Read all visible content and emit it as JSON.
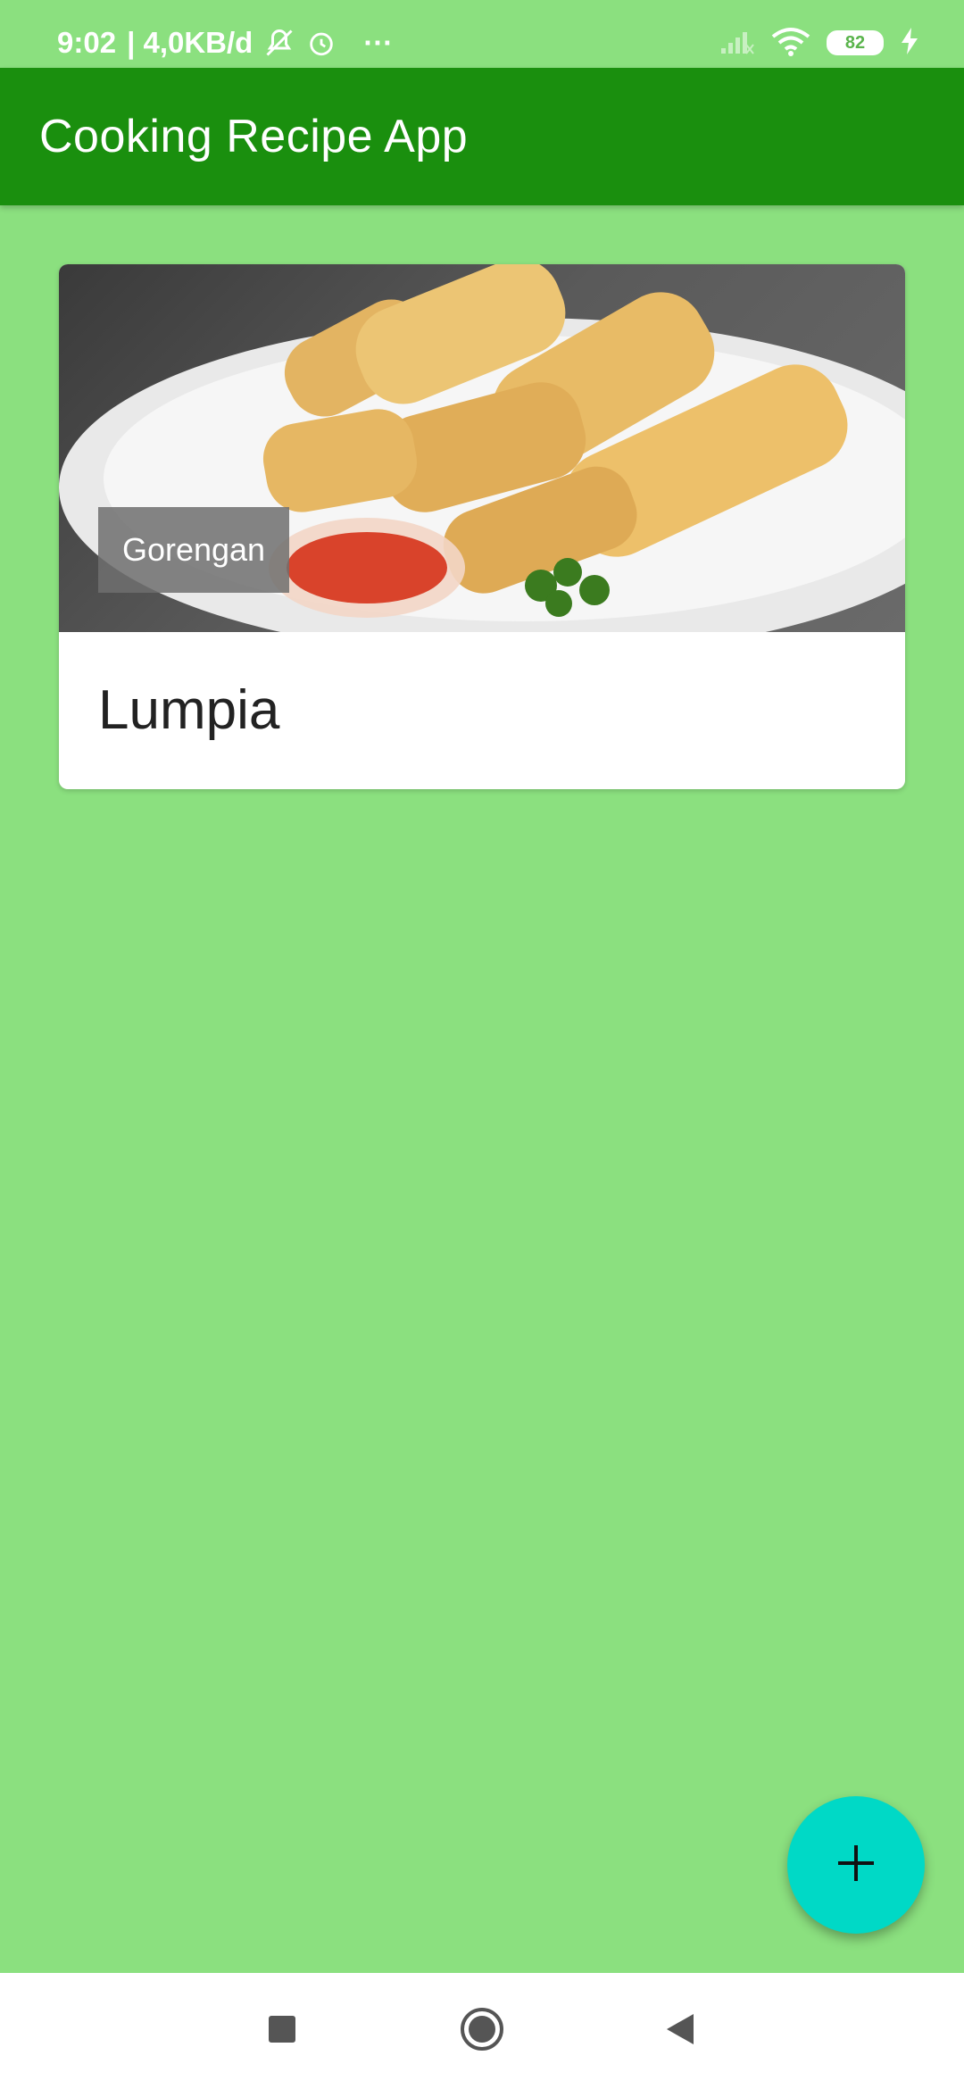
{
  "status_bar": {
    "time": "9:02",
    "network_speed": "| 4,0KB/d",
    "more": "···",
    "battery_level": "82",
    "icons": [
      "mute-icon",
      "alarm-icon",
      "signal-icon",
      "wifi-icon",
      "battery-icon",
      "charging-icon"
    ]
  },
  "app_bar": {
    "title": "Cooking Recipe App",
    "color": "#1a8f0e"
  },
  "recipes": [
    {
      "category": "Gorengan",
      "name": "Lumpia",
      "image": "spring-rolls-photo"
    }
  ],
  "fab": {
    "icon": "plus-icon",
    "color": "#00d9c6"
  },
  "navigation": {
    "items": [
      "recent-apps-icon",
      "home-icon",
      "back-icon"
    ]
  },
  "colors": {
    "background": "#8be07f",
    "app_bar": "#1a8f0e",
    "fab": "#00d9c6"
  }
}
